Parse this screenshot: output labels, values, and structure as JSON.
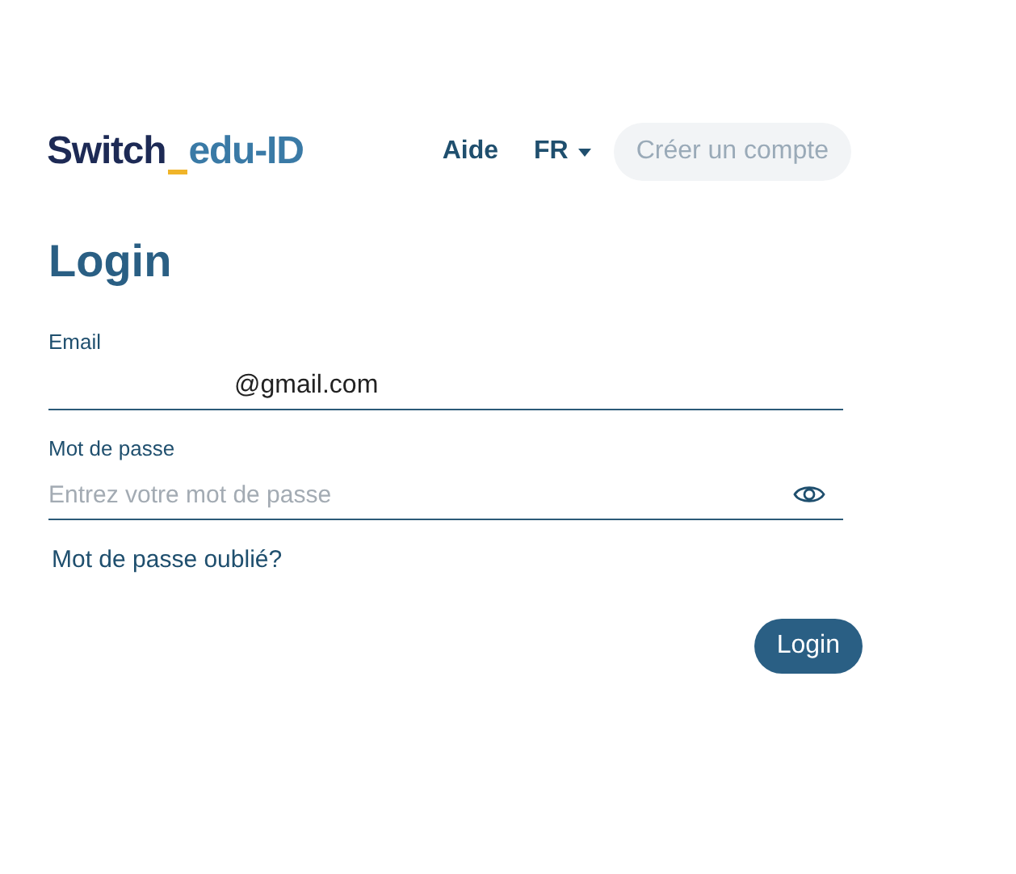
{
  "header": {
    "logo": {
      "brand": "Switch",
      "product": "edu-ID"
    },
    "help_link": "Aide",
    "language": "FR",
    "create_account": "Créer un compte"
  },
  "title": "Login",
  "email": {
    "label": "Email",
    "value": "@gmail.com"
  },
  "password": {
    "label": "Mot de passe",
    "placeholder": "Entrez votre mot de passe"
  },
  "forgot_link": "Mot de passe oublié?",
  "submit": "Login"
}
